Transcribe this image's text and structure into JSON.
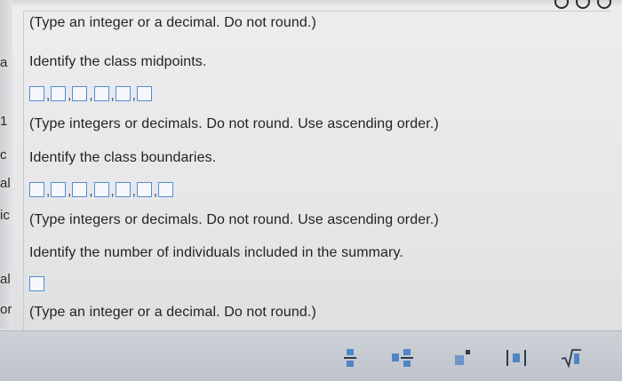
{
  "questions": {
    "note_top": "(Type an integer or a decimal. Do not round.)",
    "midpoints": {
      "prompt": "Identify the class midpoints.",
      "note": "(Type integers or decimals. Do not round. Use ascending order.)",
      "box_count": 6
    },
    "boundaries": {
      "prompt": "Identify the class boundaries.",
      "note": "(Type integers or decimals. Do not round. Use ascending order.)",
      "box_count": 7
    },
    "individuals": {
      "prompt": "Identify the number of individuals included in the summary.",
      "note": "(Type an integer or a decimal. Do not round.)",
      "box_count": 1
    }
  },
  "edge_glyphs": [
    "a",
    "1",
    "c",
    "al",
    "ic",
    "al",
    "or"
  ],
  "toolbar": {
    "icons": [
      "fraction-icon",
      "mixed-number-icon",
      "exponent-icon",
      "absolute-value-icon",
      "square-root-icon"
    ]
  },
  "colors": {
    "input_border": "#4e8ed1",
    "toolbar_bg": "#c6cad2",
    "icon_color": "#4f86c6"
  }
}
